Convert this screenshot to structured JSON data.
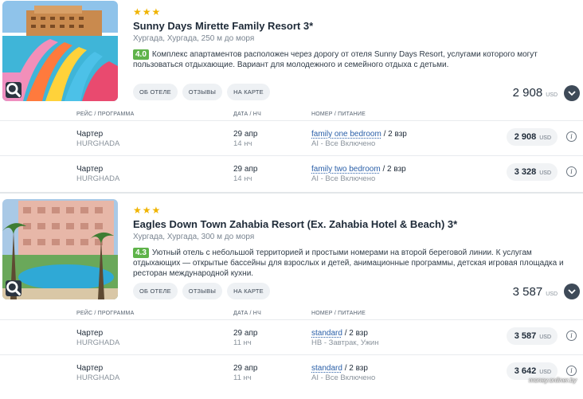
{
  "hotels": [
    {
      "stars": "★★★",
      "name": "Sunny Days Mirette Family Resort 3*",
      "location": "Хургада, Хургада, 250 м до моря",
      "rating": "4.0",
      "description": "Комплекс апартаментов расположен через дорогу от отеля Sunny Days Resort, услугами которого могут пользоваться отдыхающие. Вариант для молодежного и семейного отдыха с детьми.",
      "buttons": [
        "ОБ ОТЕЛЕ",
        "ОТЗЫВЫ",
        "НА КАРТЕ"
      ],
      "price": "2 908",
      "currency": "USD",
      "headers": [
        "РЕЙС / ПРОГРАММА",
        "ДАТА / НЧ",
        "НОМЕР / ПИТАНИЕ"
      ],
      "offers": [
        {
          "program": "Чартер",
          "city": "HURGHADA",
          "date": "29 апр",
          "nights": "14 нч",
          "room": "family one bedroom",
          "guests": " / 2 взр",
          "meal": "AI - Все Включено",
          "price": "2 908",
          "currency": "USD"
        },
        {
          "program": "Чартер",
          "city": "HURGHADA",
          "date": "29 апр",
          "nights": "14 нч",
          "room": "family two bedroom",
          "guests": " / 2 взр",
          "meal": "AI - Все Включено",
          "price": "3 328",
          "currency": "USD"
        }
      ]
    },
    {
      "stars": "★★★",
      "name": "Eagles Down Town Zahabia Resort (Ex. Zahabia Hotel & Beach) 3*",
      "location": "Хургада, Хургада, 300 м до моря",
      "rating": "4.3",
      "description": "Уютный отель с небольшой территорией и простыми номерами на второй береговой линии. К услугам отдыхающих — открытые бассейны для взрослых и детей, анимационные программы, детская игровая площадка и ресторан международной кухни.",
      "buttons": [
        "ОБ ОТЕЛЕ",
        "ОТЗЫВЫ",
        "НА КАРТЕ"
      ],
      "price": "3 587",
      "currency": "USD",
      "headers": [
        "РЕЙС / ПРОГРАММА",
        "ДАТА / НЧ",
        "НОМЕР / ПИТАНИЕ"
      ],
      "offers": [
        {
          "program": "Чартер",
          "city": "HURGHADA",
          "date": "29 апр",
          "nights": "11 нч",
          "room": "standard",
          "guests": " / 2 взр",
          "meal": "HB - Завтрак, Ужин",
          "price": "3 587",
          "currency": "USD"
        },
        {
          "program": "Чартер",
          "city": "HURGHADA",
          "date": "29 апр",
          "nights": "11 нч",
          "room": "standard",
          "guests": " / 2 взр",
          "meal": "AI - Все Включено",
          "price": "3 642",
          "currency": "USD"
        }
      ]
    }
  ],
  "watermark": "money.onliner.by",
  "icons": {
    "zoom": "magnifier-icon",
    "expand": "chevron-down-icon",
    "info": "info-icon",
    "star": "star-icon"
  },
  "colors": {
    "rating": "#5fb34a",
    "stars": "#f0b400",
    "link": "#2a5fa8"
  }
}
